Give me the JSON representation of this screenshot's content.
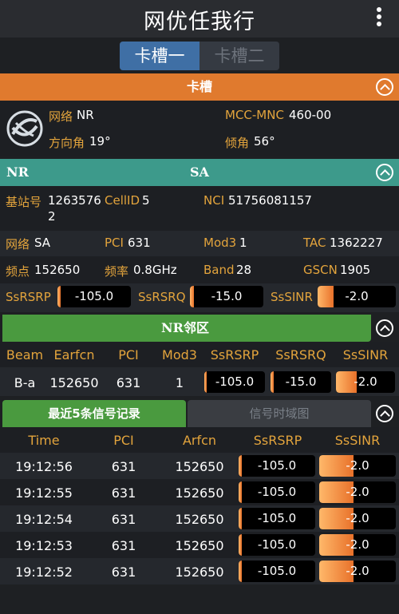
{
  "app": {
    "title": "网优任我行"
  },
  "sim_tabs": [
    "卡槽一",
    "卡槽二"
  ],
  "slot": {
    "header": "卡槽",
    "network_label": "网络",
    "network_value": "NR",
    "mcc_label": "MCC-MNC",
    "mcc_value": "460-00",
    "azimuth_label": "方向角",
    "azimuth_value": "19°",
    "tilt_label": "倾角",
    "tilt_value": "56°"
  },
  "nr_sa": {
    "header_left": "NR",
    "header_center": "SA",
    "station_label": "基站号",
    "station_value_line1": "1263576",
    "station_value_line2": "2",
    "cellid_label": "CellID",
    "cellid_value": "5",
    "nci_label": "NCI",
    "nci_value": "51756081157",
    "net_label": "网络",
    "net_value": "SA",
    "pci_label": "PCI",
    "pci_value": "631",
    "mod3_label": "Mod3",
    "mod3_value": "1",
    "tac_label": "TAC",
    "tac_value": "1362227",
    "freq_label": "频点",
    "freq_value": "152650",
    "band_freq_label": "频率",
    "band_freq_value": "0.8GHz",
    "band_label": "Band",
    "band_value": "28",
    "gscn_label": "GSCN",
    "gscn_value": "1905",
    "ssrsrp_label": "SsRSRP",
    "ssrsrp_value": "-105.0",
    "ssrsrp_level": 0.03,
    "ssrsrq_label": "SsRSRQ",
    "ssrsrq_value": "-15.0",
    "ssrsrq_level": 0.05,
    "sssinr_label": "SsSINR",
    "sssinr_value": "-2.0",
    "sssinr_level": 0.2
  },
  "neighbor": {
    "header": "NR邻区",
    "columns": [
      "Beam",
      "Earfcn",
      "PCI",
      "Mod3",
      "SsRSRP",
      "SsRSRQ",
      "SsSINR"
    ],
    "row": {
      "beam": "B-a",
      "earfcn": "152650",
      "pci": "631",
      "mod3": "1",
      "ssrsrp": "-105.0",
      "ssrsrq": "-15.0",
      "sssinr": "-2.0"
    },
    "ssrsrp_level": 0.03,
    "ssrsrq_level": 0.05,
    "sssinr_level": 0.35
  },
  "records": {
    "tab_active": "最近5条信号记录",
    "tab_inactive": "信号时域图",
    "columns": [
      "Time",
      "PCI",
      "Arfcn",
      "SsRSRP",
      "SsSINR"
    ],
    "rows": [
      {
        "time": "19:12:56",
        "pci": "631",
        "arfcn": "152650",
        "ssrsrp": "-105.0",
        "sssinr": "-2.0"
      },
      {
        "time": "19:12:55",
        "pci": "631",
        "arfcn": "152650",
        "ssrsrp": "-105.0",
        "sssinr": "-2.0"
      },
      {
        "time": "19:12:54",
        "pci": "631",
        "arfcn": "152650",
        "ssrsrp": "-105.0",
        "sssinr": "-2.0"
      },
      {
        "time": "19:12:53",
        "pci": "631",
        "arfcn": "152650",
        "ssrsrp": "-105.0",
        "sssinr": "-2.0"
      },
      {
        "time": "19:12:52",
        "pci": "631",
        "arfcn": "152650",
        "ssrsrp": "-105.0",
        "sssinr": "-2.0"
      }
    ],
    "ssrsrp_level": 0.03,
    "sssinr_level": 0.45
  },
  "colors": {
    "slot_header": "#e07a2e",
    "nr_header": "#3d9a8b",
    "neighbor_header": "#4a9a3f",
    "records_tab_active": "#4a9a3f",
    "label": "#e3a43c"
  }
}
